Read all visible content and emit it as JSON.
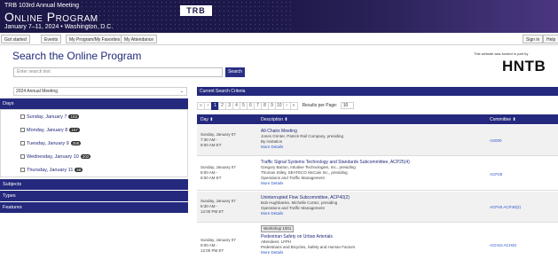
{
  "header": {
    "line1": "TRB 103rd Annual Meeting",
    "line2": "Online Program",
    "line3": "January 7–11, 2024  •  Washington, D.C.",
    "logo": "TRB"
  },
  "topnav": {
    "left": [
      "Got started",
      "Events",
      "My Program/My Favorites",
      "My Attendance"
    ],
    "right": [
      "Sign in",
      "Help"
    ]
  },
  "page_title": "Search the Online Program",
  "search": {
    "placeholder": "Enter search text",
    "button": "Search"
  },
  "sponsor": {
    "text": "This website was funded in part by",
    "logo": "HNTB"
  },
  "sidebar": {
    "meeting": "2024 Annual Meeting",
    "sections": [
      "Days",
      "Subjects",
      "Types",
      "Features"
    ],
    "days": [
      {
        "label": "Sunday, January 7",
        "count": "153"
      },
      {
        "label": "Monday, January 8",
        "count": "157"
      },
      {
        "label": "Tuesday, January 9",
        "count": "256"
      },
      {
        "label": "Wednesday, January 10",
        "count": "202"
      },
      {
        "label": "Thursday, January 11",
        "count": "58"
      }
    ]
  },
  "criteria": {
    "title": "Current Search Criteria"
  },
  "pager": {
    "pages": [
      "«",
      "‹",
      "1",
      "2",
      "3",
      "4",
      "5",
      "6",
      "7",
      "8",
      "9",
      "10",
      "›",
      "»"
    ],
    "results_label": "Results per Page:",
    "per_page": "10"
  },
  "table": {
    "headers": [
      "Day ⬍",
      "Description ⬍",
      "Committee ⬍"
    ],
    "rows": [
      {
        "day": [
          "Sunday, January 07",
          "7:30 AM -",
          "8:00 AM ET"
        ],
        "title": "All-Chairs Meeting",
        "lines": [
          "Jones Grinter, Patrick Rail Company, presiding",
          "By invitation"
        ],
        "more": "More Details",
        "committee": "AS000",
        "tag": ""
      },
      {
        "day": [
          "Sunday, January 07",
          "8:00 AM -",
          "8:00 AM ET"
        ],
        "title": "Traffic Signal Systems Technology and Standards Subcommittee, ACP25(4)",
        "lines": [
          "Gregory Barton, Intuitive Technologies, Inc., presiding",
          "Thomas Stiley, SEATECO McCain Inc., presiding",
          "Operations and Traffic Management"
        ],
        "more": "More Details",
        "committee": "ACP25",
        "tag": ""
      },
      {
        "day": [
          "Sunday, January 07",
          "8:30 AM -",
          "12:00 PM ET"
        ],
        "title": "Uninterrupted Flow Subcommittee, ACP40(2)",
        "lines": [
          "Bob Hughbanks, Michelle Cortez, presiding",
          "Operations and Traffic Management"
        ],
        "more": "More Details",
        "committee": "ACP40 ACP40(2)",
        "tag": ""
      },
      {
        "day": [
          "Sunday, January 07",
          "9:00 AM -",
          "12:00 PM ET"
        ],
        "title": "Pedestrian Safety on Urban Arterials",
        "lines": [
          "Attendees: LFPH",
          "Pedestrians and Bicycles, Safety and Human Factors"
        ],
        "more": "More Details",
        "committee": "ACH10 ACH20",
        "tag": "Workshop 1001"
      }
    ]
  }
}
